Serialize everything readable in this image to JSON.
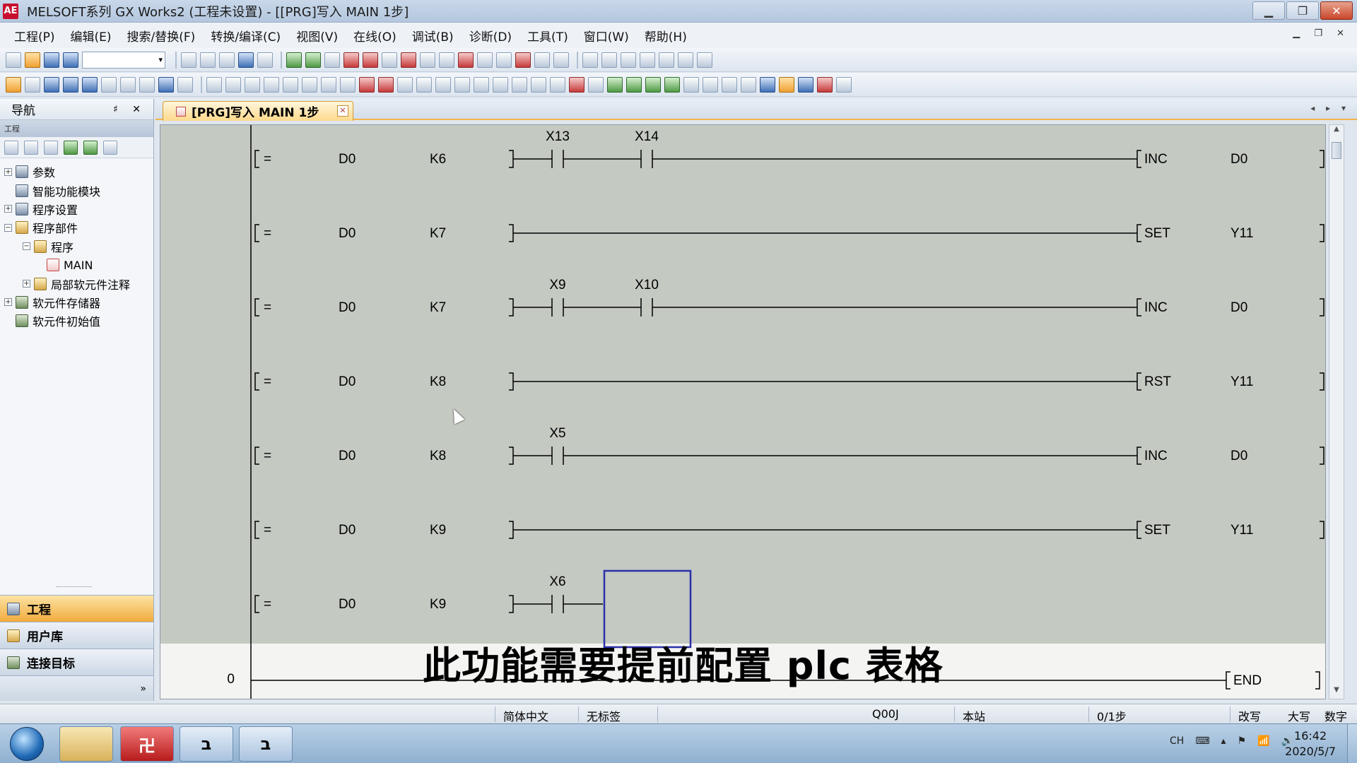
{
  "window": {
    "app_icon_text": "AE",
    "title": "MELSOFT系列 GX Works2 (工程未设置) - [[PRG]写入 MAIN 1步]",
    "minimize": "▁",
    "maximize": "❐",
    "close": "✕"
  },
  "menu": {
    "items": [
      "工程(P)",
      "编辑(E)",
      "搜索/替换(F)",
      "转换/编译(C)",
      "视图(V)",
      "在线(O)",
      "调试(B)",
      "诊断(D)",
      "工具(T)",
      "窗口(W)",
      "帮助(H)"
    ],
    "mdi_controls": "▁ ❐ ✕"
  },
  "navigation": {
    "title": "导航",
    "pin": "♯ ✕",
    "section": "工程",
    "tree": [
      {
        "label": "参数",
        "expander": "+",
        "indent": 0,
        "icon": "gear-icon"
      },
      {
        "label": "智能功能模块",
        "expander": "",
        "indent": 0,
        "icon": "gear-icon"
      },
      {
        "label": "程序设置",
        "expander": "+",
        "indent": 0,
        "icon": "gear-icon"
      },
      {
        "label": "程序部件",
        "expander": "−",
        "indent": 0,
        "icon": "folder-icon"
      },
      {
        "label": "程序",
        "expander": "−",
        "indent": 1,
        "icon": "folder-icon"
      },
      {
        "label": "MAIN",
        "expander": "",
        "indent": 2,
        "icon": "program-icon"
      },
      {
        "label": "局部软元件注释",
        "expander": "+",
        "indent": 1,
        "icon": "folder-icon"
      },
      {
        "label": "软元件存储器",
        "expander": "+",
        "indent": 0,
        "icon": "memory-icon"
      },
      {
        "label": "软元件初始值",
        "expander": "",
        "indent": 0,
        "icon": "memory-icon"
      }
    ],
    "bottom_buttons": [
      "工程",
      "用户库",
      "连接目标"
    ],
    "more": "»"
  },
  "tab": {
    "label": "[PRG]写入 MAIN 1步",
    "close": "✕",
    "nav": "◂ ▸ ▾"
  },
  "ladder": {
    "rungs": [
      {
        "op": "=",
        "s1": "D0",
        "s2": "K6",
        "contacts": [
          "X13",
          "X14"
        ],
        "instr": "INC",
        "dev": "D0"
      },
      {
        "op": "=",
        "s1": "D0",
        "s2": "K7",
        "contacts": [],
        "instr": "SET",
        "dev": "Y11"
      },
      {
        "op": "=",
        "s1": "D0",
        "s2": "K7",
        "contacts": [
          "X9",
          "X10"
        ],
        "instr": "INC",
        "dev": "D0"
      },
      {
        "op": "=",
        "s1": "D0",
        "s2": "K8",
        "contacts": [],
        "instr": "RST",
        "dev": "Y11"
      },
      {
        "op": "=",
        "s1": "D0",
        "s2": "K8",
        "contacts": [
          "X5"
        ],
        "instr": "INC",
        "dev": "D0"
      },
      {
        "op": "=",
        "s1": "D0",
        "s2": "K9",
        "contacts": [],
        "instr": "SET",
        "dev": "Y11"
      },
      {
        "op": "=",
        "s1": "D0",
        "s2": "K9",
        "contacts": [
          "X6"
        ],
        "instr": "",
        "dev": ""
      }
    ],
    "end_step": "0",
    "end_label": "END"
  },
  "subtitle": "此功能需要提前配置 plc 表格",
  "statusbar": {
    "language": "简体中文",
    "label": "无标签",
    "cpu": "Q00J",
    "station": "本站",
    "step": "0/1步",
    "mode": "改写",
    "caps": "大写",
    "num": "数字"
  },
  "taskbar": {
    "apps": [
      "folder",
      "GX Works2",
      "MELSOFT",
      "MELSOFT"
    ],
    "gx_icon_text": "卍",
    "melsoft_icon_text": "ב",
    "tray": [
      "CH",
      "⌨",
      "▴",
      "⚑",
      "📶",
      "🔊"
    ],
    "time": "16:42",
    "date": "2020/5/7"
  }
}
